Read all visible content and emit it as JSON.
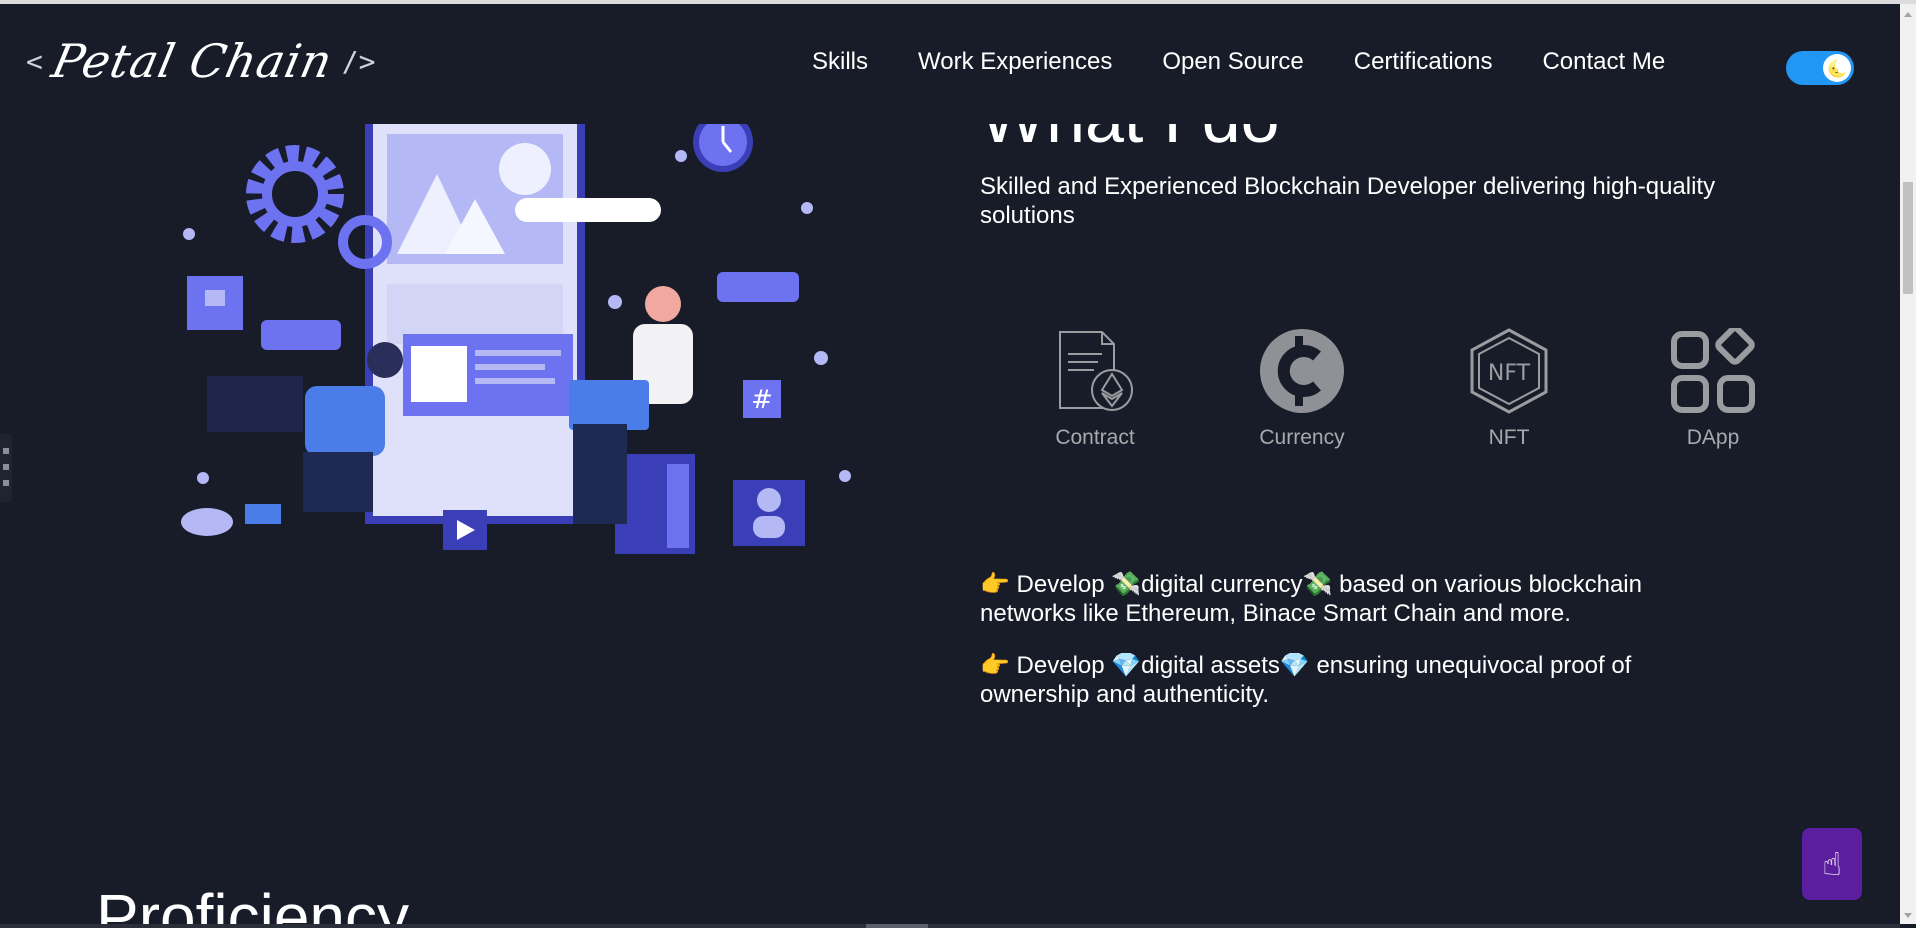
{
  "header": {
    "logo": {
      "bracket_open": "<",
      "name": "Petal Chain",
      "bracket_close": "/>"
    },
    "nav": [
      {
        "label": "Skills"
      },
      {
        "label": "Work Experiences"
      },
      {
        "label": "Open Source"
      },
      {
        "label": "Certifications"
      },
      {
        "label": "Contact Me"
      }
    ],
    "theme_toggle": {
      "state": "dark",
      "icon": "moon-icon"
    }
  },
  "section": {
    "heading": "What I do",
    "subtitle": "Skilled and Experienced Blockchain Developer delivering high-quality solutions",
    "skills": [
      {
        "label": "Contract",
        "icon": "contract-document-icon"
      },
      {
        "label": "Currency",
        "icon": "currency-coin-icon"
      },
      {
        "label": "NFT",
        "icon": "nft-hexagon-icon"
      },
      {
        "label": "DApp",
        "icon": "dapp-grid-icon"
      }
    ],
    "points": [
      "👉 Develop 💸digital currency💸 based on various blockchain networks like Ethereum, Binace Smart Chain and more.",
      "👉 Develop 💎digital assets💎 ensuring unequivocal proof of ownership and authenticity."
    ]
  },
  "next_section": {
    "heading": "Proficiency"
  },
  "floating": {
    "chat_button_icon": "pointing-hand-icon"
  },
  "colors": {
    "background": "#171c28",
    "accent": "#2196f3",
    "illustration": "#6c72f0",
    "chat_button": "#5b1e9e"
  }
}
